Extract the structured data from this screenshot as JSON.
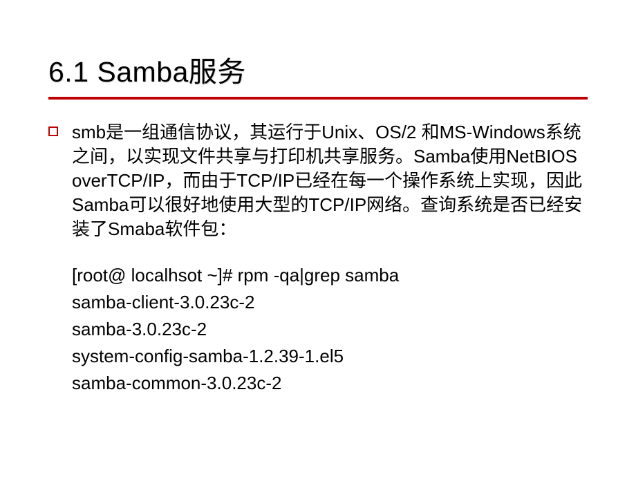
{
  "title": "6.1 Samba服务",
  "paragraph": "smb是一组通信协议，其运行于Unix、OS/2 和MS-Windows系统之间，以实现文件共享与打印机共享服务。Samba使用NetBIOS overTCP/IP，而由于TCP/IP已经在每一个操作系统上实现，因此Samba可以很好地使用大型的TCP/IP网络。查询系统是否已经安装了Smaba软件包：",
  "commands": {
    "line1": "[root@ localhsot ~]# rpm -qa|grep samba",
    "line2": "samba-client-3.0.23c-2",
    "line3": "samba-3.0.23c-2",
    "line4": "system-config-samba-1.2.39-1.el5",
    "line5": "samba-common-3.0.23c-2"
  }
}
